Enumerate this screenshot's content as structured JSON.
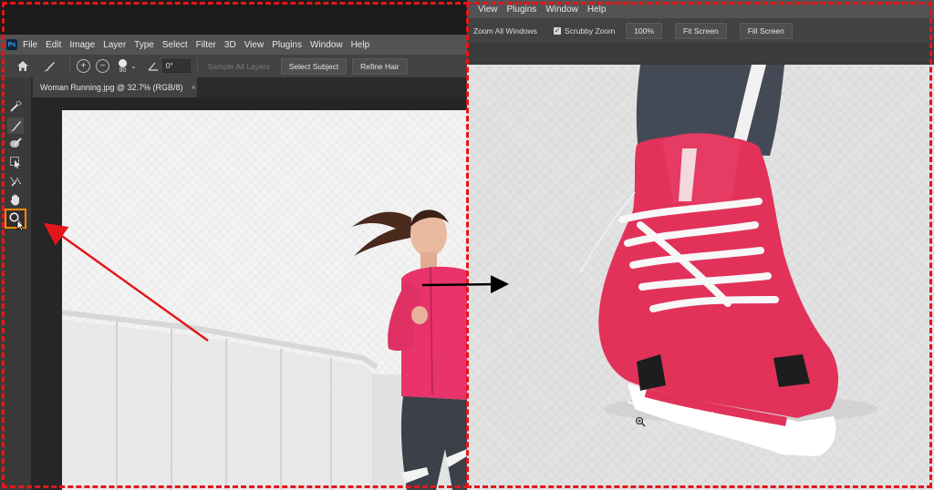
{
  "left_window": {
    "menu": [
      "File",
      "Edit",
      "Image",
      "Layer",
      "Type",
      "Select",
      "Filter",
      "3D",
      "View",
      "Plugins",
      "Window",
      "Help"
    ],
    "logo_text": "Ps",
    "options": {
      "brush_size": "90",
      "angle_value": "0°",
      "sample_all_layers": "Sample All Layers",
      "select_subject": "Select Subject",
      "refine_hair": "Refine Hair"
    },
    "document_tab": {
      "title": "Woman Running.jpg @ 32.7% (RGB/8)",
      "close": "×"
    },
    "tools": [
      "quick-selection-icon",
      "refine-edge-brush-icon",
      "brush-icon",
      "object-selection-icon",
      "lasso-icon",
      "hand-icon",
      "zoom-icon"
    ],
    "selected_tool": "zoom-icon"
  },
  "right_window": {
    "menu": [
      "View",
      "Plugins",
      "Window",
      "Help"
    ],
    "options": {
      "zoom_all_windows": "Zoom All Windows",
      "scrubby_zoom": "Scrubby Zoom",
      "zoom_level": "100%",
      "fit_screen": "Fit Screen",
      "fill_screen": "Fill Screen"
    }
  },
  "colors": {
    "highlight": "#ff8a00",
    "annotation_red": "#e3161c",
    "annotation_black": "#000000",
    "jacket_pink": "#e8336b",
    "shoe_red": "#e03055"
  }
}
